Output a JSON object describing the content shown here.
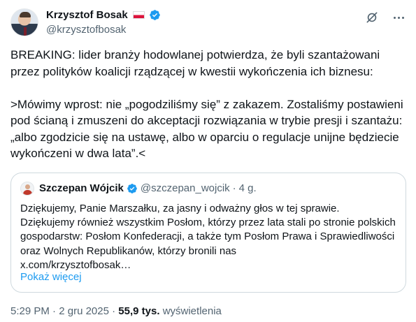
{
  "author": {
    "name": "Krzysztof Bosak",
    "handle": "@krzysztofbosak",
    "flag_colors": [
      "#ffffff",
      "#dc143c"
    ],
    "verified_color": "#1d9bf0"
  },
  "tweet": {
    "text": "BREAKING: lider branży hodowlanej potwierdza, że byli szantażowani przez polityków koalicji rządzącej w kwestii wykończenia ich biznesu:\n\n>Mówimy wprost: nie „pogodziliśmy się” z zakazem. Zostaliśmy postawieni pod ścianą i zmuszeni do akceptacji rozwiązania w trybie presji i szantażu: „albo zgodzicie się na ustawę, albo w oparciu o regulacje unijne będziecie wykończeni w dwa lata”.<"
  },
  "quote": {
    "name": "Szczepan Wójcik",
    "handle": "@szczepan_wojcik",
    "separator": "·",
    "time": "4 g.",
    "text": "Dziękujemy, Panie Marszałku, za jasny i odważny głos w tej sprawie.\nDziękujemy również wszystkim Posłom, którzy przez lata stali po stronie polskich gospodarstw: Posłom Konfederacji, a także tym Posłom Prawa i Sprawiedliwości oraz Wolnych Republikanów, którzy bronili nas\nx.com/krzysztofbosak…",
    "show_more": "Pokaż więcej"
  },
  "footer": {
    "time": "5:29 PM",
    "separator": "·",
    "date": "2 gru 2025",
    "views_count": "55,9 tys.",
    "views_label": "wyświetlenia"
  },
  "icons": {
    "grok": "grok-icon",
    "more": "more-options-icon",
    "verified": "verified-badge-icon"
  },
  "colors": {
    "text": "#0f1419",
    "secondary": "#536471",
    "link": "#1d9bf0",
    "border": "#cfd9de"
  }
}
